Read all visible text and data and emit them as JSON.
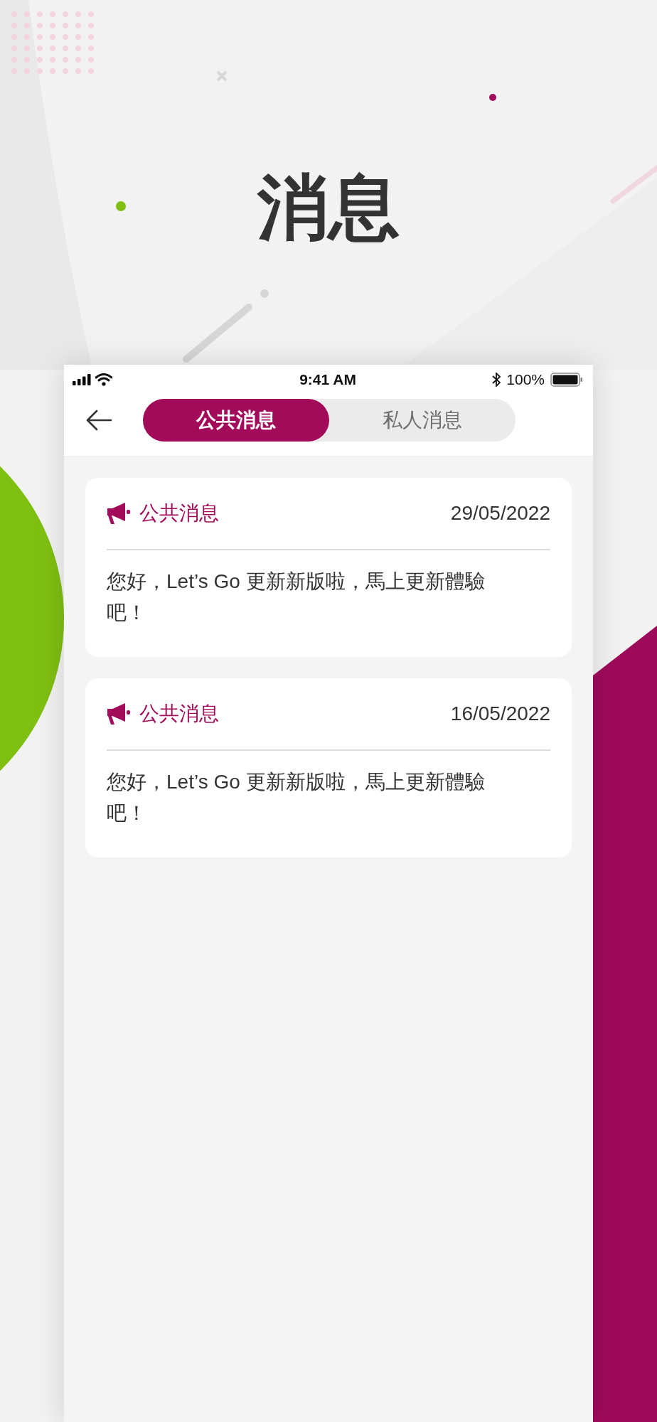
{
  "headline": "消息",
  "status_bar": {
    "time": "9:41 AM",
    "battery": "100%"
  },
  "nav": {
    "tabs": [
      {
        "label": "公共消息",
        "selected": true
      },
      {
        "label": "私人消息",
        "selected": false
      }
    ]
  },
  "messages": [
    {
      "category": "公共消息",
      "date": "29/05/2022",
      "text": "您好，Let’s Go 更新新版啦，馬上更新體驗吧！"
    },
    {
      "category": "公共消息",
      "date": "16/05/2022",
      "text": "您好，Let’s Go 更新新版啦，馬上更新體驗吧！"
    }
  ]
}
